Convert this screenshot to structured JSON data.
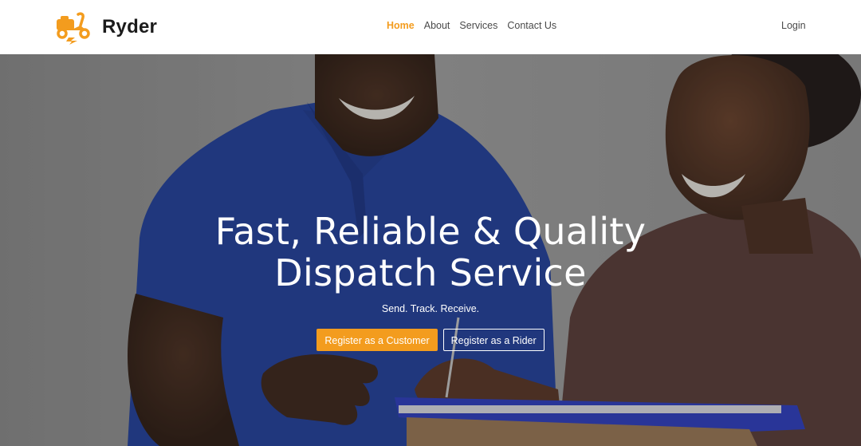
{
  "brand": {
    "name": "Ryder",
    "logo_icon": "scooter-icon",
    "accent_color": "#f39c1e"
  },
  "nav": {
    "items": [
      {
        "label": "Home",
        "active": true
      },
      {
        "label": "About",
        "active": false
      },
      {
        "label": "Services",
        "active": false
      },
      {
        "label": "Contact Us",
        "active": false
      }
    ],
    "login_label": "Login"
  },
  "hero": {
    "title_line1": "Fast, Reliable & Quality",
    "title_line2": "Dispatch Service",
    "subtitle": "Send. Track. Receive.",
    "primary_button": "Register as a Customer",
    "secondary_button": "Register as a Rider"
  }
}
